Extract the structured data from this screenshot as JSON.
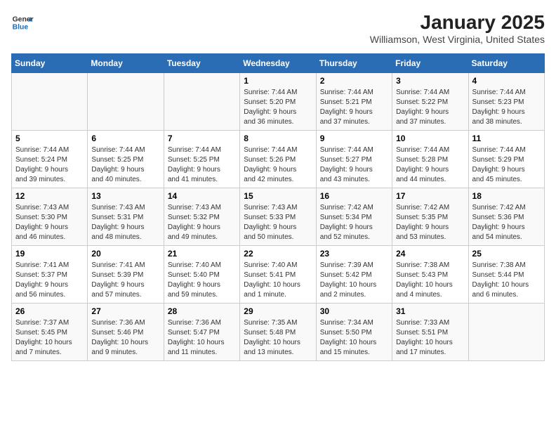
{
  "header": {
    "logo_line1": "General",
    "logo_line2": "Blue",
    "title": "January 2025",
    "subtitle": "Williamson, West Virginia, United States"
  },
  "weekdays": [
    "Sunday",
    "Monday",
    "Tuesday",
    "Wednesday",
    "Thursday",
    "Friday",
    "Saturday"
  ],
  "weeks": [
    [
      {
        "day": "",
        "info": ""
      },
      {
        "day": "",
        "info": ""
      },
      {
        "day": "",
        "info": ""
      },
      {
        "day": "1",
        "info": "Sunrise: 7:44 AM\nSunset: 5:20 PM\nDaylight: 9 hours\nand 36 minutes."
      },
      {
        "day": "2",
        "info": "Sunrise: 7:44 AM\nSunset: 5:21 PM\nDaylight: 9 hours\nand 37 minutes."
      },
      {
        "day": "3",
        "info": "Sunrise: 7:44 AM\nSunset: 5:22 PM\nDaylight: 9 hours\nand 37 minutes."
      },
      {
        "day": "4",
        "info": "Sunrise: 7:44 AM\nSunset: 5:23 PM\nDaylight: 9 hours\nand 38 minutes."
      }
    ],
    [
      {
        "day": "5",
        "info": "Sunrise: 7:44 AM\nSunset: 5:24 PM\nDaylight: 9 hours\nand 39 minutes."
      },
      {
        "day": "6",
        "info": "Sunrise: 7:44 AM\nSunset: 5:25 PM\nDaylight: 9 hours\nand 40 minutes."
      },
      {
        "day": "7",
        "info": "Sunrise: 7:44 AM\nSunset: 5:25 PM\nDaylight: 9 hours\nand 41 minutes."
      },
      {
        "day": "8",
        "info": "Sunrise: 7:44 AM\nSunset: 5:26 PM\nDaylight: 9 hours\nand 42 minutes."
      },
      {
        "day": "9",
        "info": "Sunrise: 7:44 AM\nSunset: 5:27 PM\nDaylight: 9 hours\nand 43 minutes."
      },
      {
        "day": "10",
        "info": "Sunrise: 7:44 AM\nSunset: 5:28 PM\nDaylight: 9 hours\nand 44 minutes."
      },
      {
        "day": "11",
        "info": "Sunrise: 7:44 AM\nSunset: 5:29 PM\nDaylight: 9 hours\nand 45 minutes."
      }
    ],
    [
      {
        "day": "12",
        "info": "Sunrise: 7:43 AM\nSunset: 5:30 PM\nDaylight: 9 hours\nand 46 minutes."
      },
      {
        "day": "13",
        "info": "Sunrise: 7:43 AM\nSunset: 5:31 PM\nDaylight: 9 hours\nand 48 minutes."
      },
      {
        "day": "14",
        "info": "Sunrise: 7:43 AM\nSunset: 5:32 PM\nDaylight: 9 hours\nand 49 minutes."
      },
      {
        "day": "15",
        "info": "Sunrise: 7:43 AM\nSunset: 5:33 PM\nDaylight: 9 hours\nand 50 minutes."
      },
      {
        "day": "16",
        "info": "Sunrise: 7:42 AM\nSunset: 5:34 PM\nDaylight: 9 hours\nand 52 minutes."
      },
      {
        "day": "17",
        "info": "Sunrise: 7:42 AM\nSunset: 5:35 PM\nDaylight: 9 hours\nand 53 minutes."
      },
      {
        "day": "18",
        "info": "Sunrise: 7:42 AM\nSunset: 5:36 PM\nDaylight: 9 hours\nand 54 minutes."
      }
    ],
    [
      {
        "day": "19",
        "info": "Sunrise: 7:41 AM\nSunset: 5:37 PM\nDaylight: 9 hours\nand 56 minutes."
      },
      {
        "day": "20",
        "info": "Sunrise: 7:41 AM\nSunset: 5:39 PM\nDaylight: 9 hours\nand 57 minutes."
      },
      {
        "day": "21",
        "info": "Sunrise: 7:40 AM\nSunset: 5:40 PM\nDaylight: 9 hours\nand 59 minutes."
      },
      {
        "day": "22",
        "info": "Sunrise: 7:40 AM\nSunset: 5:41 PM\nDaylight: 10 hours\nand 1 minute."
      },
      {
        "day": "23",
        "info": "Sunrise: 7:39 AM\nSunset: 5:42 PM\nDaylight: 10 hours\nand 2 minutes."
      },
      {
        "day": "24",
        "info": "Sunrise: 7:38 AM\nSunset: 5:43 PM\nDaylight: 10 hours\nand 4 minutes."
      },
      {
        "day": "25",
        "info": "Sunrise: 7:38 AM\nSunset: 5:44 PM\nDaylight: 10 hours\nand 6 minutes."
      }
    ],
    [
      {
        "day": "26",
        "info": "Sunrise: 7:37 AM\nSunset: 5:45 PM\nDaylight: 10 hours\nand 7 minutes."
      },
      {
        "day": "27",
        "info": "Sunrise: 7:36 AM\nSunset: 5:46 PM\nDaylight: 10 hours\nand 9 minutes."
      },
      {
        "day": "28",
        "info": "Sunrise: 7:36 AM\nSunset: 5:47 PM\nDaylight: 10 hours\nand 11 minutes."
      },
      {
        "day": "29",
        "info": "Sunrise: 7:35 AM\nSunset: 5:48 PM\nDaylight: 10 hours\nand 13 minutes."
      },
      {
        "day": "30",
        "info": "Sunrise: 7:34 AM\nSunset: 5:50 PM\nDaylight: 10 hours\nand 15 minutes."
      },
      {
        "day": "31",
        "info": "Sunrise: 7:33 AM\nSunset: 5:51 PM\nDaylight: 10 hours\nand 17 minutes."
      },
      {
        "day": "",
        "info": ""
      }
    ]
  ]
}
